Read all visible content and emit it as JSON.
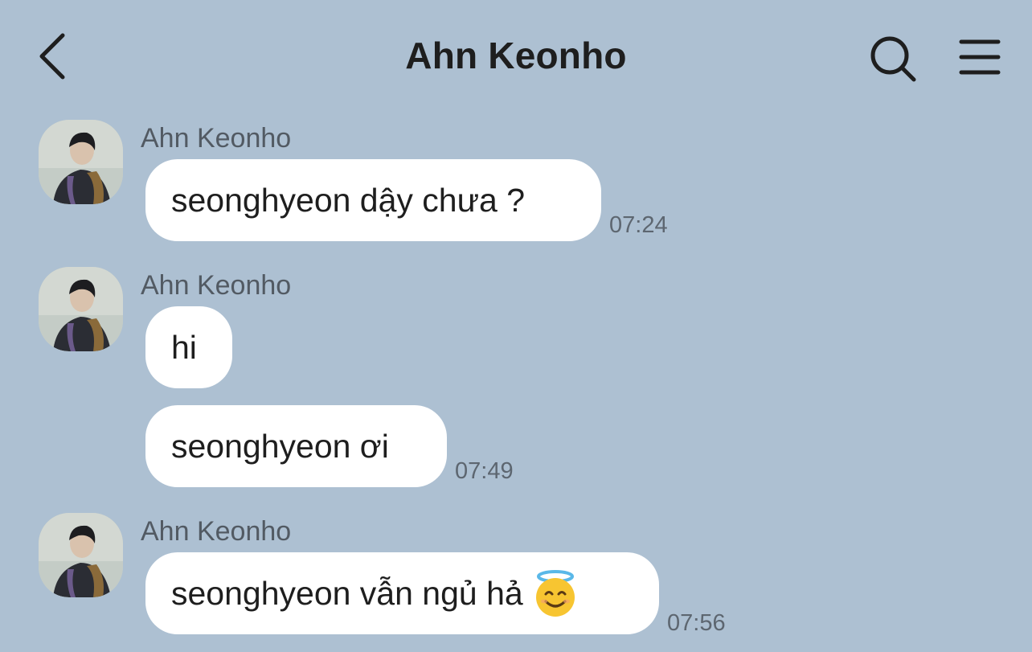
{
  "header": {
    "title": "Ahn Keonho",
    "back_icon": "chevron-left-icon",
    "search_icon": "search-icon",
    "menu_icon": "hamburger-menu-icon"
  },
  "messages": [
    {
      "sender": "Ahn Keonho",
      "bubbles": [
        {
          "text": "seonghyeon dậy chưa ?",
          "time": "07:24"
        }
      ]
    },
    {
      "sender": "Ahn Keonho",
      "bubbles": [
        {
          "text": "hi",
          "time": ""
        },
        {
          "text": "seonghyeon ơi",
          "time": "07:49"
        }
      ]
    },
    {
      "sender": "Ahn Keonho",
      "bubbles": [
        {
          "text": "seonghyeon vẫn ngủ hả",
          "emoji": "smiling-face-with-halo-emoji",
          "time": "07:56"
        }
      ]
    }
  ],
  "colors": {
    "background": "#adc0d2",
    "bubble": "#ffffff",
    "text": "#1e1e1e"
  }
}
